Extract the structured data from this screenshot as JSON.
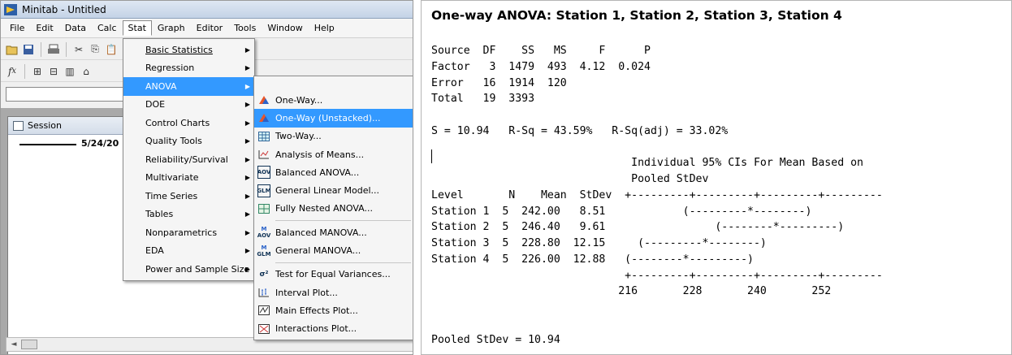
{
  "window": {
    "title": "Minitab - Untitled",
    "menubar": [
      "File",
      "Edit",
      "Data",
      "Calc",
      "Stat",
      "Graph",
      "Editor",
      "Tools",
      "Window",
      "Help"
    ],
    "open_menu": "Stat"
  },
  "toolbar": {
    "icons": [
      "open-file-icon",
      "save-icon",
      "print-icon",
      "cut-icon",
      "copy-icon",
      "paste-icon",
      "undo-icon",
      "help-icon",
      "info-icon"
    ]
  },
  "session": {
    "tab_label": "Session",
    "date_text": "5/24/20"
  },
  "stat_menu": {
    "items": [
      "Basic Statistics",
      "Regression",
      "ANOVA",
      "DOE",
      "Control Charts",
      "Quality Tools",
      "Reliability/Survival",
      "Multivariate",
      "Time Series",
      "Tables",
      "Nonparametrics",
      "EDA",
      "Power and Sample Size"
    ],
    "selected": "ANOVA"
  },
  "anova_menu": {
    "items": [
      {
        "label": "One-Way...",
        "icon": "one-way-icon"
      },
      {
        "label": "One-Way (Unstacked)...",
        "icon": "one-way-unstacked-icon"
      },
      {
        "label": "Two-Way...",
        "icon": "two-way-icon"
      },
      {
        "label": "Analysis of Means...",
        "icon": "analysis-of-means-icon"
      },
      {
        "label": "Balanced ANOVA...",
        "icon": "aov-icon"
      },
      {
        "label": "General Linear Model...",
        "icon": "glm-icon"
      },
      {
        "label": "Fully Nested ANOVA...",
        "icon": "nested-icon"
      },
      {
        "label": "Balanced MANOVA...",
        "icon": "manova-aov-icon"
      },
      {
        "label": "General MANOVA...",
        "icon": "manova-glm-icon"
      },
      {
        "label": "Test for Equal Variances...",
        "icon": "equal-variances-icon"
      },
      {
        "label": "Interval Plot...",
        "icon": "interval-plot-icon"
      },
      {
        "label": "Main Effects Plot...",
        "icon": "main-effects-icon"
      },
      {
        "label": "Interactions Plot...",
        "icon": "interactions-icon"
      }
    ],
    "selected": "One-Way (Unstacked)..."
  },
  "output": {
    "title": "One-way ANOVA: Station 1, Station 2, Station 3, Station 4",
    "lines": [
      "Source  DF    SS   MS     F      P",
      "Factor   3  1479  493  4.12  0.024",
      "Error   16  1914  120",
      "Total   19  3393",
      "",
      "S = 10.94   R-Sq = 43.59%   R-Sq(adj) = 33.02%",
      "",
      "                               Individual 95% CIs For Mean Based on",
      "                               Pooled StDev",
      "Level       N    Mean  StDev  +---------+---------+---------+---------",
      "Station 1  5  242.00   8.51            (---------*--------)",
      "Station 2  5  246.40   9.61                 (--------*---------)",
      "Station 3  5  228.80  12.15     (---------*--------)",
      "Station 4  5  226.00  12.88   (--------*---------)",
      "                              +---------+---------+---------+---------",
      "                             216       228       240       252",
      "",
      "",
      "Pooled StDev = 10.94"
    ]
  }
}
